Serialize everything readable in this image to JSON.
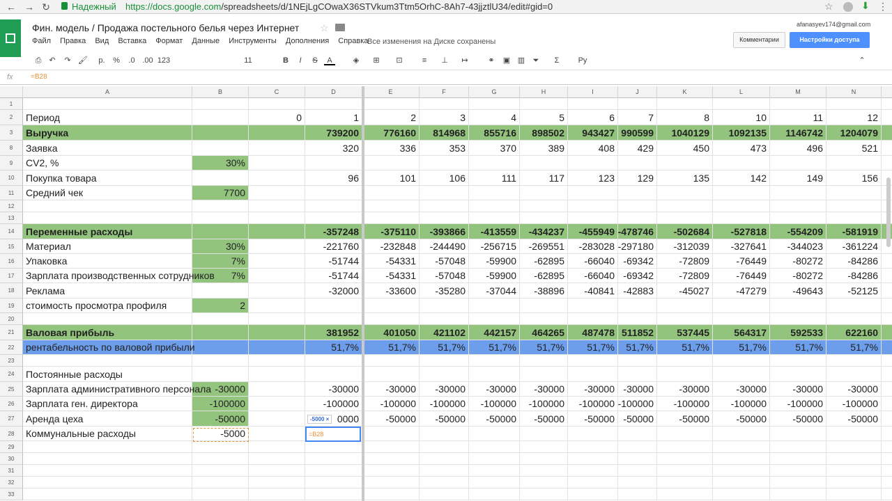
{
  "browser": {
    "secure_label": "Надежный",
    "url_host": "https://docs.google.com",
    "url_path": "/spreadsheets/d/1NEjLgCOwaX36STVkum3Ttm5OrhC-8Ah7-43jjztlU34/edit#gid=0"
  },
  "app": {
    "title": "Фин. модель / Продажа постельного белья через Интернет",
    "account": "afanasyev174@gmail.com",
    "comments_label": "Комментарии",
    "share_label": "Настройки доступа",
    "saved_status": "Все изменения на Диске сохранены",
    "menu": [
      "Файл",
      "Правка",
      "Вид",
      "Вставка",
      "Формат",
      "Данные",
      "Инструменты",
      "Дополнения",
      "Справка"
    ]
  },
  "toolbar": {
    "currency": "р.",
    "percent": "%",
    "dec_less": ".0",
    "dec_more": ".00",
    "format_more": "123",
    "font_size": "11",
    "bold": "B",
    "italic": "I",
    "strike": "S",
    "text_color": "A",
    "functions": "Σ",
    "input_lang": "Ру"
  },
  "formula_bar": {
    "fx": "fx",
    "value": "=B28"
  },
  "columns": [
    "A",
    "B",
    "C",
    "D",
    "E",
    "F",
    "G",
    "H",
    "I",
    "J",
    "K",
    "L",
    "M",
    "N"
  ],
  "rows": [
    {
      "n": "1",
      "cells": [
        "",
        "",
        "",
        "",
        "",
        "",
        "",
        "",
        "",
        "",
        "",
        "",
        "",
        ""
      ]
    },
    {
      "n": "2",
      "cells": [
        "Период",
        "",
        "0",
        "1",
        "2",
        "3",
        "4",
        "5",
        "6",
        "7",
        "8",
        "10",
        "11",
        "12"
      ]
    },
    {
      "n": "3",
      "style": "green-bold",
      "cells": [
        "Выручка",
        "",
        "",
        "739200",
        "776160",
        "814968",
        "855716",
        "898502",
        "943427",
        "990599",
        "1040129",
        "1092135",
        "1146742",
        "1204079"
      ]
    },
    {
      "n": "8",
      "cells": [
        "Заявка",
        "",
        "",
        "320",
        "336",
        "353",
        "370",
        "389",
        "408",
        "429",
        "450",
        "473",
        "496",
        "521"
      ]
    },
    {
      "n": "9",
      "cells": [
        "CV2, %",
        "30%",
        "",
        "",
        "",
        "",
        "",
        "",
        "",
        "",
        "",
        "",
        "",
        ""
      ],
      "greenB": true
    },
    {
      "n": "10",
      "cells": [
        "Покупка товара",
        "",
        "",
        "96",
        "101",
        "106",
        "111",
        "117",
        "123",
        "129",
        "135",
        "142",
        "149",
        "156"
      ]
    },
    {
      "n": "11",
      "cells": [
        "Средний чек",
        "7700",
        "",
        "",
        "",
        "",
        "",
        "",
        "",
        "",
        "",
        "",
        "",
        ""
      ],
      "greenB": true
    },
    {
      "n": "12",
      "cells": [
        "",
        "",
        "",
        "",
        "",
        "",
        "",
        "",
        "",
        "",
        "",
        "",
        "",
        ""
      ]
    },
    {
      "n": "13",
      "cells": [
        "",
        "",
        "",
        "",
        "",
        "",
        "",
        "",
        "",
        "",
        "",
        "",
        "",
        ""
      ]
    },
    {
      "n": "14",
      "style": "green-bold",
      "cells": [
        "Переменные расходы",
        "",
        "",
        "-357248",
        "-375110",
        "-393866",
        "-413559",
        "-434237",
        "-455949",
        "-478746",
        "-502684",
        "-527818",
        "-554209",
        "-581919"
      ]
    },
    {
      "n": "15",
      "cells": [
        "Материал",
        "30%",
        "",
        "-221760",
        "-232848",
        "-244490",
        "-256715",
        "-269551",
        "-283028",
        "-297180",
        "-312039",
        "-327641",
        "-344023",
        "-361224"
      ],
      "greenB": true
    },
    {
      "n": "16",
      "cells": [
        "Упаковка",
        "7%",
        "",
        "-51744",
        "-54331",
        "-57048",
        "-59900",
        "-62895",
        "-66040",
        "-69342",
        "-72809",
        "-76449",
        "-80272",
        "-84286"
      ],
      "greenB": true
    },
    {
      "n": "17",
      "cells": [
        "Зарплата производственных сотрудников",
        "7%",
        "",
        "-51744",
        "-54331",
        "-57048",
        "-59900",
        "-62895",
        "-66040",
        "-69342",
        "-72809",
        "-76449",
        "-80272",
        "-84286"
      ],
      "greenB": true
    },
    {
      "n": "18",
      "cells": [
        "Реклама",
        "",
        "",
        "-32000",
        "-33600",
        "-35280",
        "-37044",
        "-38896",
        "-40841",
        "-42883",
        "-45027",
        "-47279",
        "-49643",
        "-52125"
      ]
    },
    {
      "n": "19",
      "cells": [
        "стоимость просмотра профиля",
        "2",
        "",
        "",
        "",
        "",
        "",
        "",
        "",
        "",
        "",
        "",
        "",
        ""
      ],
      "greenB": true
    },
    {
      "n": "20",
      "cells": [
        "",
        "",
        "",
        "",
        "",
        "",
        "",
        "",
        "",
        "",
        "",
        "",
        "",
        ""
      ]
    },
    {
      "n": "21",
      "style": "green-bold",
      "cells": [
        "Валовая прибыль",
        "",
        "",
        "381952",
        "401050",
        "421102",
        "442157",
        "464265",
        "487478",
        "511852",
        "537445",
        "564317",
        "592533",
        "622160"
      ]
    },
    {
      "n": "22",
      "style": "blue",
      "cells": [
        "рентабельность по валовой прибыли",
        "",
        "",
        "51,7%",
        "51,7%",
        "51,7%",
        "51,7%",
        "51,7%",
        "51,7%",
        "51,7%",
        "51,7%",
        "51,7%",
        "51,7%",
        "51,7%"
      ]
    },
    {
      "n": "23",
      "cells": [
        "",
        "",
        "",
        "",
        "",
        "",
        "",
        "",
        "",
        "",
        "",
        "",
        "",
        ""
      ]
    },
    {
      "n": "24",
      "cells": [
        "Постоянные расходы",
        "",
        "",
        "",
        "",
        "",
        "",
        "",
        "",
        "",
        "",
        "",
        "",
        ""
      ]
    },
    {
      "n": "25",
      "cells": [
        "Зарплата административного персонала",
        "-30000",
        "",
        "-30000",
        "-30000",
        "-30000",
        "-30000",
        "-30000",
        "-30000",
        "-30000",
        "-30000",
        "-30000",
        "-30000",
        "-30000"
      ],
      "greenB": true
    },
    {
      "n": "26",
      "cells": [
        "Зарплата ген. директора",
        "-100000",
        "",
        "-100000",
        "-100000",
        "-100000",
        "-100000",
        "-100000",
        "-100000",
        "-100000",
        "-100000",
        "-100000",
        "-100000",
        "-100000"
      ],
      "greenB": true
    },
    {
      "n": "27",
      "cells": [
        "Аренда цеха",
        "-50000",
        "",
        "0000",
        "-50000",
        "-50000",
        "-50000",
        "-50000",
        "-50000",
        "-50000",
        "-50000",
        "-50000",
        "-50000",
        "-50000"
      ],
      "greenB": true
    },
    {
      "n": "28",
      "cells": [
        "Коммунальные расходы",
        "-5000",
        "",
        "",
        "",
        "",
        "",
        "",
        "",
        "",
        "",
        "",
        "",
        ""
      ]
    },
    {
      "n": "29",
      "cells": [
        "",
        "",
        "",
        "",
        "",
        "",
        "",
        "",
        "",
        "",
        "",
        "",
        "",
        ""
      ]
    },
    {
      "n": "30",
      "cells": [
        "",
        "",
        "",
        "",
        "",
        "",
        "",
        "",
        "",
        "",
        "",
        "",
        "",
        ""
      ]
    },
    {
      "n": "31",
      "cells": [
        "",
        "",
        "",
        "",
        "",
        "",
        "",
        "",
        "",
        "",
        "",
        "",
        "",
        ""
      ]
    },
    {
      "n": "32",
      "cells": [
        "",
        "",
        "",
        "",
        "",
        "",
        "",
        "",
        "",
        "",
        "",
        "",
        "",
        ""
      ]
    },
    {
      "n": "33",
      "cells": [
        "",
        "",
        "",
        "",
        "",
        "",
        "",
        "",
        "",
        "",
        "",
        "",
        "",
        ""
      ]
    }
  ],
  "editing": {
    "tooltip": "-5000 ×",
    "formula": "=B28"
  },
  "colors": {
    "green": "#93c47d",
    "blue": "#6d9eeb",
    "accent": "#4285f4",
    "sheets_green": "#1f9d55"
  }
}
